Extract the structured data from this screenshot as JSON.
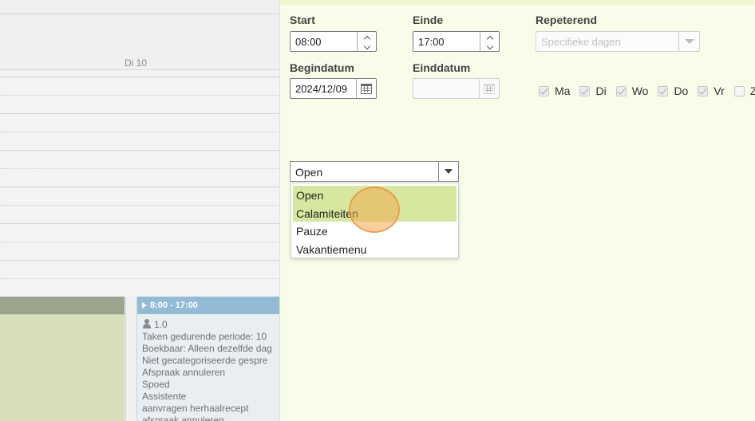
{
  "calendar": {
    "day_label": "Di 10",
    "events": {
      "blue": {
        "time": "8:00 - 17:00",
        "capacity": "1.0",
        "lines": [
          "Taken gedurende periode: 10",
          "Boekbaar: Alleen dezelfde dag",
          "Niet gecategoriseerde gespre",
          "Afspraak annuleren",
          "Spoed",
          "Assistente",
          "aanvragen herhaalrecept",
          "afspraak annuleren"
        ]
      }
    }
  },
  "form": {
    "start": {
      "label": "Start",
      "value": "08:00"
    },
    "end": {
      "label": "Einde",
      "value": "17:00"
    },
    "repeat": {
      "label": "Repeterend",
      "placeholder": "Specifieke dagen"
    },
    "begin_date": {
      "label": "Begindatum",
      "value": "2024/12/09"
    },
    "end_date": {
      "label": "Einddatum",
      "value": ""
    },
    "weekdays": [
      {
        "label": "Ma",
        "checked": true
      },
      {
        "label": "Di",
        "checked": true
      },
      {
        "label": "Wo",
        "checked": true
      },
      {
        "label": "Do",
        "checked": true
      },
      {
        "label": "Vr",
        "checked": true
      },
      {
        "label": "Za",
        "checked": false
      }
    ],
    "type_select": {
      "value": "Open",
      "options": [
        "Open",
        "Calamiteiten",
        "Pauze",
        "Vakantiemenu"
      ],
      "highlighted": [
        "Open",
        "Calamiteiten"
      ]
    }
  },
  "colors": {
    "panel_bg": "#f8fde9",
    "highlight": "#d6e89f",
    "event_blue": "#93bbd6",
    "event_green": "#d6deba"
  }
}
